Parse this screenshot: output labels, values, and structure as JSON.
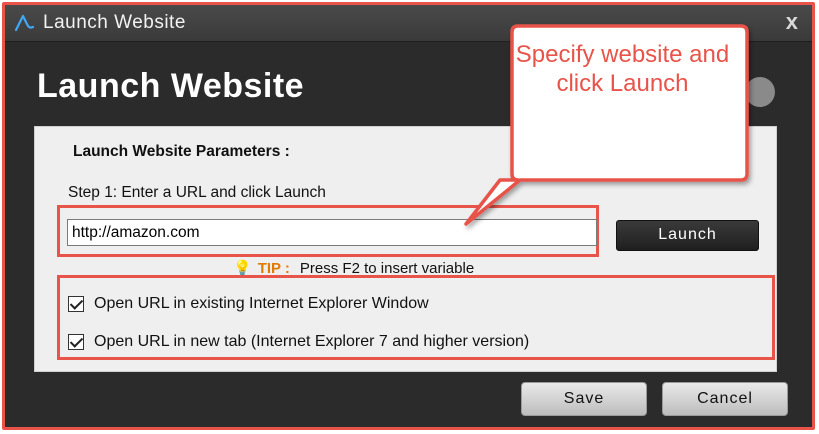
{
  "window": {
    "title": "Launch Website",
    "close_glyph": "x"
  },
  "dialog": {
    "heading": "Launch Website",
    "params_label": "Launch Website Parameters :",
    "step_label": "Step 1: Enter a URL and click Launch",
    "url_value": "http://amazon.com",
    "launch_label": "Launch",
    "tip": {
      "icon": "lightbulb-icon",
      "label": "TIP :",
      "text": "Press F2 to insert variable"
    },
    "options": [
      {
        "label": "Open URL in existing Internet Explorer Window",
        "checked": true
      },
      {
        "label": "Open URL in new tab (Internet Explorer 7 and higher version)",
        "checked": true
      }
    ],
    "save_label": "Save",
    "cancel_label": "Cancel"
  },
  "callout": {
    "text": "Specify website and click Launch",
    "color": "#e8534a"
  },
  "colors": {
    "highlight": "#e8534a",
    "window_bg": "#2b2b2b",
    "panel_bg": "#efefef"
  }
}
